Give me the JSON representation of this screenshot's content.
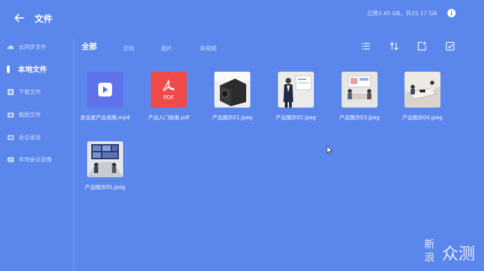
{
  "header": {
    "title": "文件",
    "storage_text": "已用3.45 GB，共25.17 GB"
  },
  "sidebar": {
    "items": [
      {
        "label": "云同步文件",
        "icon": "cloud-icon"
      },
      {
        "label": "本地文件",
        "icon": "active-indicator"
      },
      {
        "label": "下载文件",
        "icon": "download-icon"
      },
      {
        "label": "截图文件",
        "icon": "camera-icon"
      },
      {
        "label": "会议录音",
        "icon": "audio-icon"
      },
      {
        "label": "本地会议录像",
        "icon": "video-icon"
      }
    ]
  },
  "tabs": [
    {
      "label": "全部",
      "active": true
    },
    {
      "label": "文档",
      "active": false
    },
    {
      "label": "图片",
      "active": false
    },
    {
      "label": "音视频",
      "active": false
    }
  ],
  "toolbar": [
    "list-view-icon",
    "sort-icon",
    "add-folder-icon",
    "select-icon"
  ],
  "files": [
    {
      "name": "会议星产品视频.mp4",
      "type": "video"
    },
    {
      "name": "产品入门指南.pdf",
      "type": "pdf",
      "badge": "PDF"
    },
    {
      "name": "产品图示01.jpeg",
      "type": "image"
    },
    {
      "name": "产品图示02.jpeg",
      "type": "image"
    },
    {
      "name": "产品图示03.jpeg",
      "type": "image"
    },
    {
      "name": "产品图示04.jpeg",
      "type": "image"
    },
    {
      "name": "产品图示05.jpeg",
      "type": "image"
    }
  ],
  "watermark": {
    "line1": "新",
    "line2": "浪",
    "line3": "众测"
  },
  "colors": {
    "background": "#5b86ec",
    "video_tile": "#5e72eb",
    "pdf_tile": "#ef4b4b"
  }
}
